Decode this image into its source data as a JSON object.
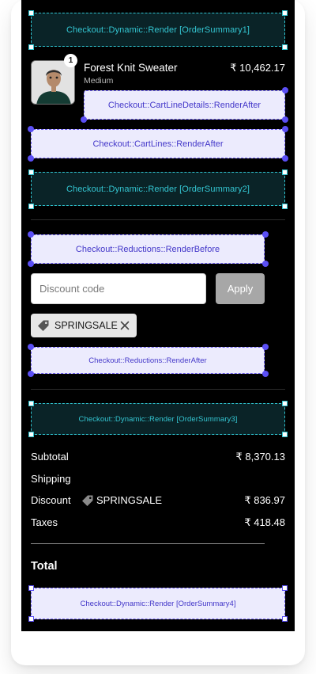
{
  "extensions": {
    "order_summary_1": "Checkout::Dynamic::Render [OrderSummary1]",
    "cart_line_details_after": "Checkout::CartLineDetails::RenderAfter",
    "cart_lines_after": "Checkout::CartLines::RenderAfter",
    "order_summary_2": "Checkout::Dynamic::Render [OrderSummary2]",
    "reductions_before": "Checkout::Reductions::RenderBefore",
    "reductions_after": "Checkout::Reductions::RenderAfter",
    "order_summary_3": "Checkout::Dynamic::Render [OrderSummary3]",
    "order_summary_4": "Checkout::Dynamic::Render [OrderSummary4]"
  },
  "cart_line": {
    "quantity": "1",
    "title": "Forest Knit Sweater",
    "variant": "Medium",
    "price": "₹ 10,462.17"
  },
  "discount": {
    "placeholder": "Discount code",
    "apply_label": "Apply",
    "applied_code": "SPRINGSALE"
  },
  "summary": {
    "subtotal_label": "Subtotal",
    "subtotal_value": "₹ 8,370.13",
    "shipping_label": "Shipping",
    "discount_label": "Discount",
    "discount_code": "SPRINGSALE",
    "discount_value": "₹ 836.97",
    "taxes_label": "Taxes",
    "taxes_value": "₹ 418.48",
    "total_label": "Total"
  },
  "icons": {
    "tag": "tag-icon",
    "close": "close-icon",
    "product": "product-thumbnail"
  },
  "colors": {
    "background": "#000000",
    "dynamic_extension": "#34c6d2",
    "static_extension": "#5b4ff5",
    "apply_button": "#a7a7a7"
  }
}
